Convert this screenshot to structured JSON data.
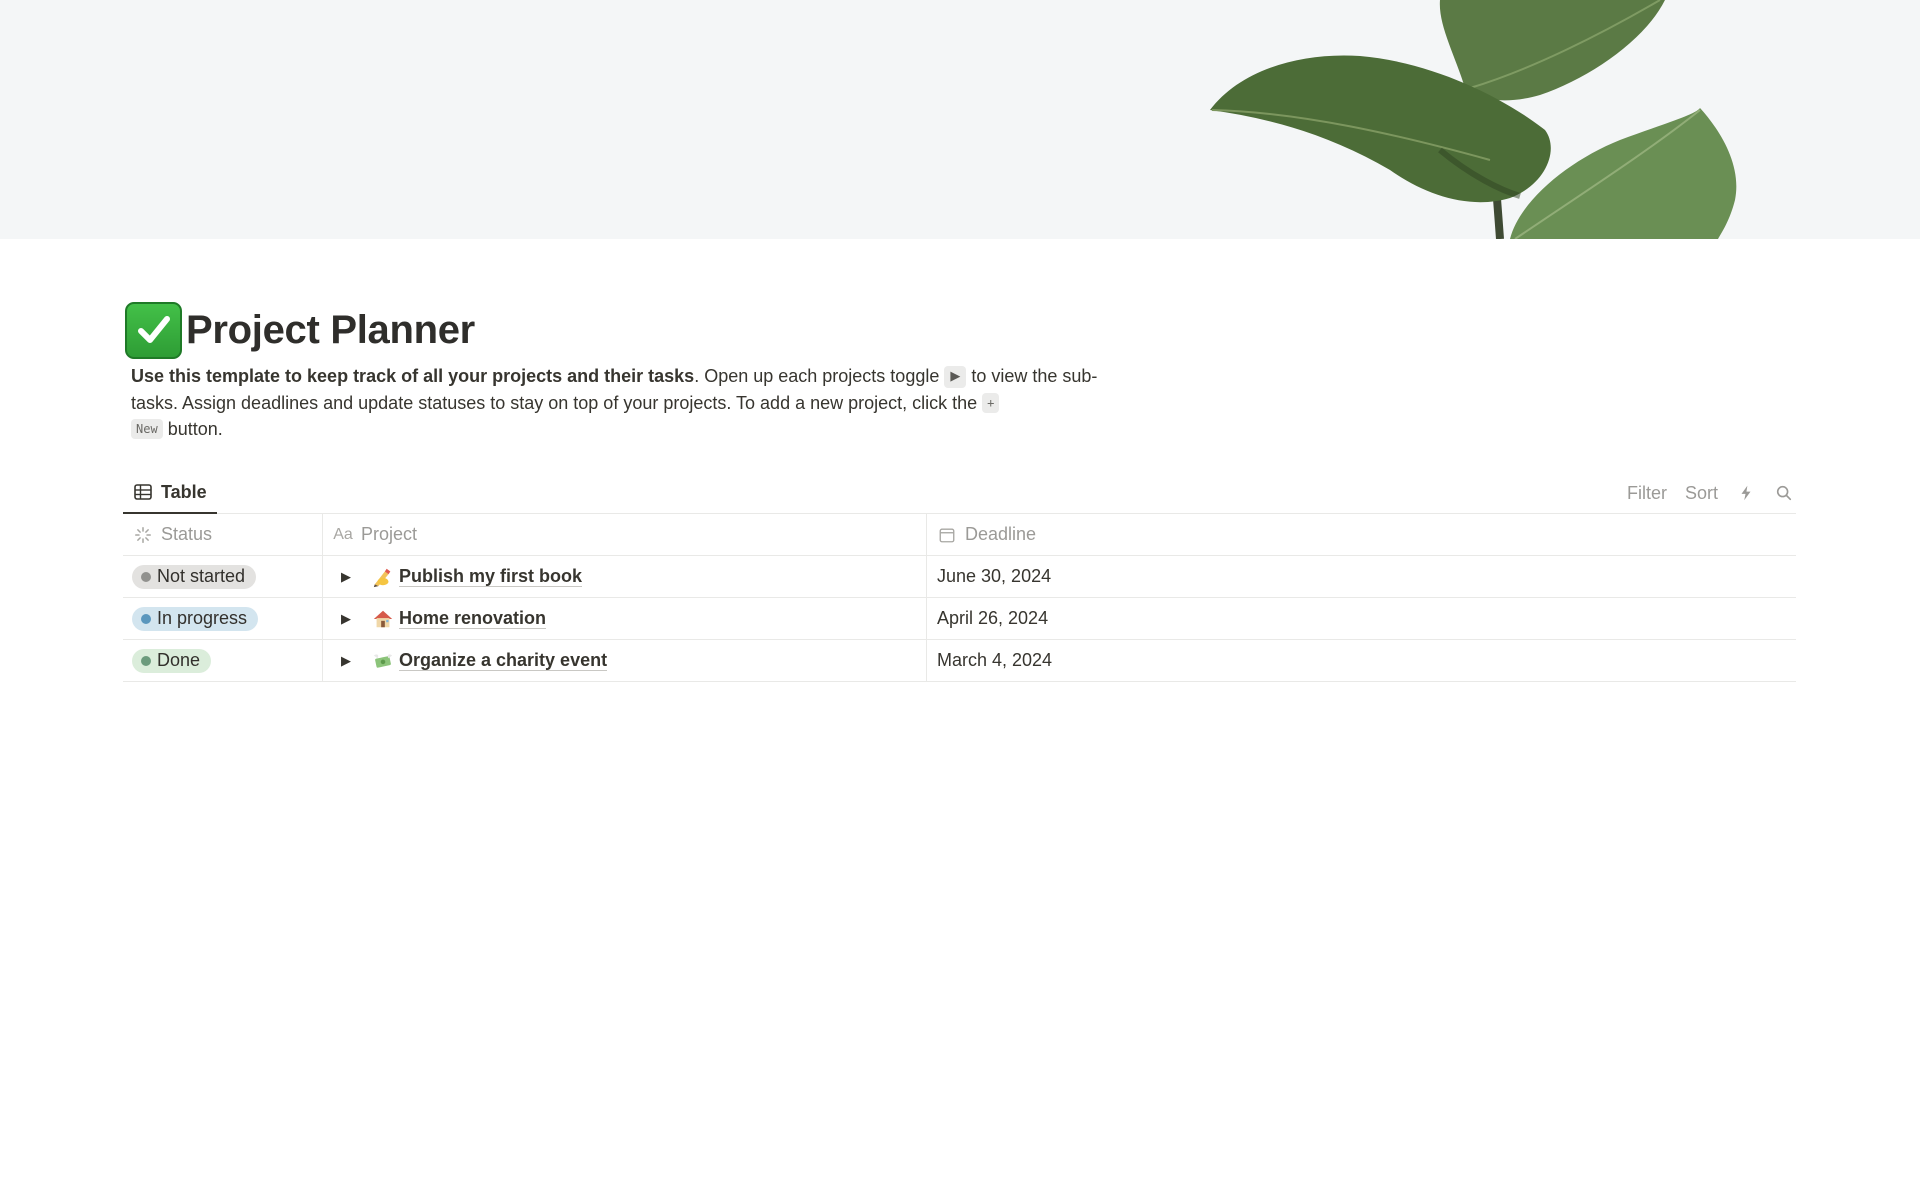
{
  "page": {
    "title": "Project Planner",
    "icon": "check-mark-button-icon",
    "description": {
      "bold": "Use this template to keep track of all your projects and their tasks",
      "part1": ". Open up each projects toggle ",
      "toggle_key": "▶",
      "part2": " to view the sub-tasks. Assign deadlines and update statuses to stay on top of your projects. To add a new project, click the ",
      "new_key_plus": "+",
      "new_key_label": "New",
      "part3": " button."
    }
  },
  "view": {
    "tab_label": "Table",
    "tab_icon": "table-icon",
    "actions": {
      "filter": "Filter",
      "sort": "Sort",
      "automation_icon": "lightning-icon",
      "search_icon": "search-icon"
    }
  },
  "table": {
    "columns": [
      {
        "label": "Status",
        "icon": "status-icon"
      },
      {
        "label": "Project",
        "icon": "text-property-icon"
      },
      {
        "label": "Deadline",
        "icon": "calendar-icon"
      }
    ],
    "rows": [
      {
        "status": "Not started",
        "status_bg": "#e3e2e0",
        "status_dot": "#91918e",
        "emoji": "writing-hand-icon",
        "project": "Publish my first book",
        "deadline": "June 30, 2024"
      },
      {
        "status": "In progress",
        "status_bg": "#d3e5ef",
        "status_dot": "#5b97bd",
        "emoji": "house-icon",
        "project": "Home renovation",
        "deadline": "April 26, 2024"
      },
      {
        "status": "Done",
        "status_bg": "#dbeddb",
        "status_dot": "#6c9b7d",
        "emoji": "money-with-wings-icon",
        "project": "Organize a charity event",
        "deadline": "March 4, 2024"
      }
    ]
  }
}
